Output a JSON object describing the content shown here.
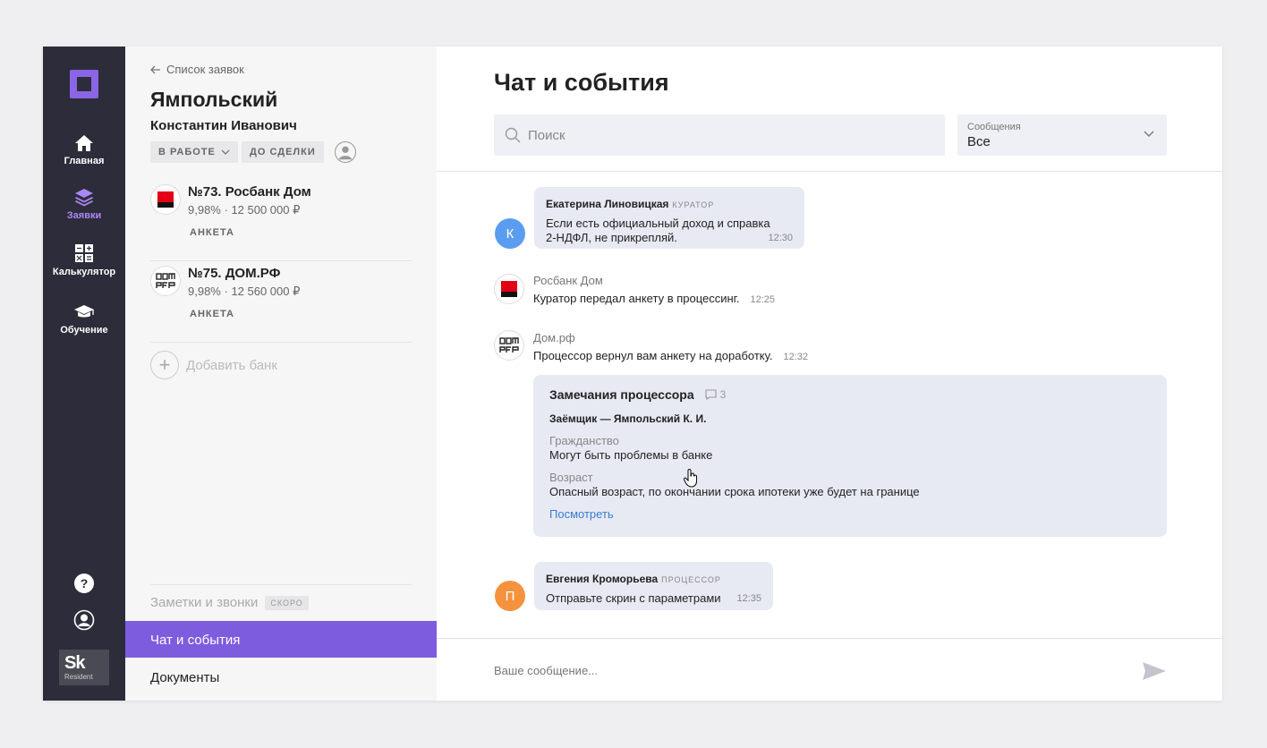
{
  "nav": {
    "items": [
      {
        "label": "Главная",
        "icon": "home-icon"
      },
      {
        "label": "Заявки",
        "icon": "layers-icon"
      },
      {
        "label": "Калькулятор",
        "icon": "calculator-icon"
      },
      {
        "label": "Обучение",
        "icon": "graduation-cap-icon"
      }
    ],
    "active_index": 1,
    "accent": "#8a66e6",
    "sk_logo": "Sk",
    "sk_sub": "Resident"
  },
  "client": {
    "back_label": "Список заявок",
    "last_name": "Ямпольский",
    "first_name": "Константин Иванович",
    "status_tag": "В РАБОТЕ",
    "stage_tag": "ДО СДЕЛКИ",
    "banks": [
      {
        "name": "№73. Росбанк Дом",
        "rate": "9,98%",
        "amount": "12 500 000 ₽",
        "status": "АНКЕТА"
      },
      {
        "name": "№75. ДОМ.РФ",
        "rate": "9,98%",
        "amount": "12 560 000 ₽",
        "status": "АНКЕТА"
      }
    ],
    "add_bank": "Добавить банк",
    "notes_label": "Заметки и звонки",
    "soon_badge": "СКОРО",
    "tab_chat": "Чат и события",
    "tab_docs": "Документы"
  },
  "chat": {
    "title": "Чат и события",
    "search_placeholder": "Поиск",
    "filter_label": "Сообщения",
    "filter_value": "Все",
    "messages": [
      {
        "initial": "К",
        "author": "Екатерина Линовицкая",
        "role": "КУРАТОР",
        "line1": "Если есть официальный доход и справка",
        "line2": "2-НДФЛ, не прикрепляй.",
        "time": "12:30",
        "avatar_color": "#5a9cf0"
      },
      {
        "initial": "П",
        "author": "Евгения Кроморьева",
        "role": "ПРОЦЕССОР",
        "text": "Отправьте скрин с параметрами",
        "time": "12:35",
        "avatar_color": "#f5923e"
      }
    ],
    "events": [
      {
        "source": "Росбанк Дом",
        "text": "Куратор передал анкету в процессинг.",
        "time": "12:25"
      },
      {
        "source": "Дом.рф",
        "text": "Процессор вернул вам анкету на доработку.",
        "time": "12:32"
      }
    ],
    "remarks": {
      "title": "Замечания процессора",
      "count": "3",
      "borrower": "Заёмщик — Ямпольский К. И.",
      "items": [
        {
          "key": "Гражданство",
          "value": "Могут быть проблемы в банке"
        },
        {
          "key": "Возраст",
          "value": "Опасный возраст, по окончании срока ипотеки уже будет на границе"
        }
      ],
      "link": "Посмотреть"
    },
    "composer_placeholder": "Ваше сообщение..."
  }
}
